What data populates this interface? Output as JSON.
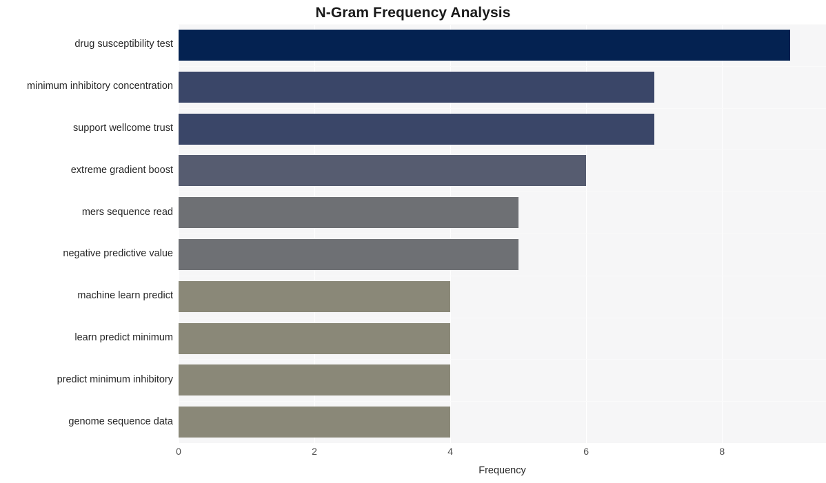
{
  "chart_data": {
    "type": "bar",
    "orientation": "horizontal",
    "title": "N-Gram Frequency Analysis",
    "xlabel": "Frequency",
    "ylabel": "",
    "categories": [
      "drug susceptibility test",
      "minimum inhibitory concentration",
      "support wellcome trust",
      "extreme gradient boost",
      "mers sequence read",
      "negative predictive value",
      "machine learn predict",
      "learn predict minimum",
      "predict minimum inhibitory",
      "genome sequence data"
    ],
    "values": [
      9,
      7,
      7,
      6,
      5,
      5,
      4,
      4,
      4,
      4
    ],
    "bar_colors": [
      "#042251",
      "#3a4668",
      "#3a4668",
      "#565c70",
      "#6e7074",
      "#6e7074",
      "#8a8878",
      "#8a8878",
      "#8a8878",
      "#8a8878"
    ],
    "xlim": [
      0,
      9.53
    ],
    "xticks": [
      0,
      2,
      4,
      6,
      8
    ],
    "xtick_labels": [
      "0",
      "2",
      "4",
      "6",
      "8"
    ],
    "grid": true,
    "grid_axis": "both",
    "legend": "none",
    "plot_background": "#f6f6f7",
    "figure_background": "#ffffff",
    "gridline_color": "#ffffff",
    "title_color": "#1a1a1a",
    "tick_label_color": "#4d4d4d",
    "axis_label_color": "#262626"
  }
}
